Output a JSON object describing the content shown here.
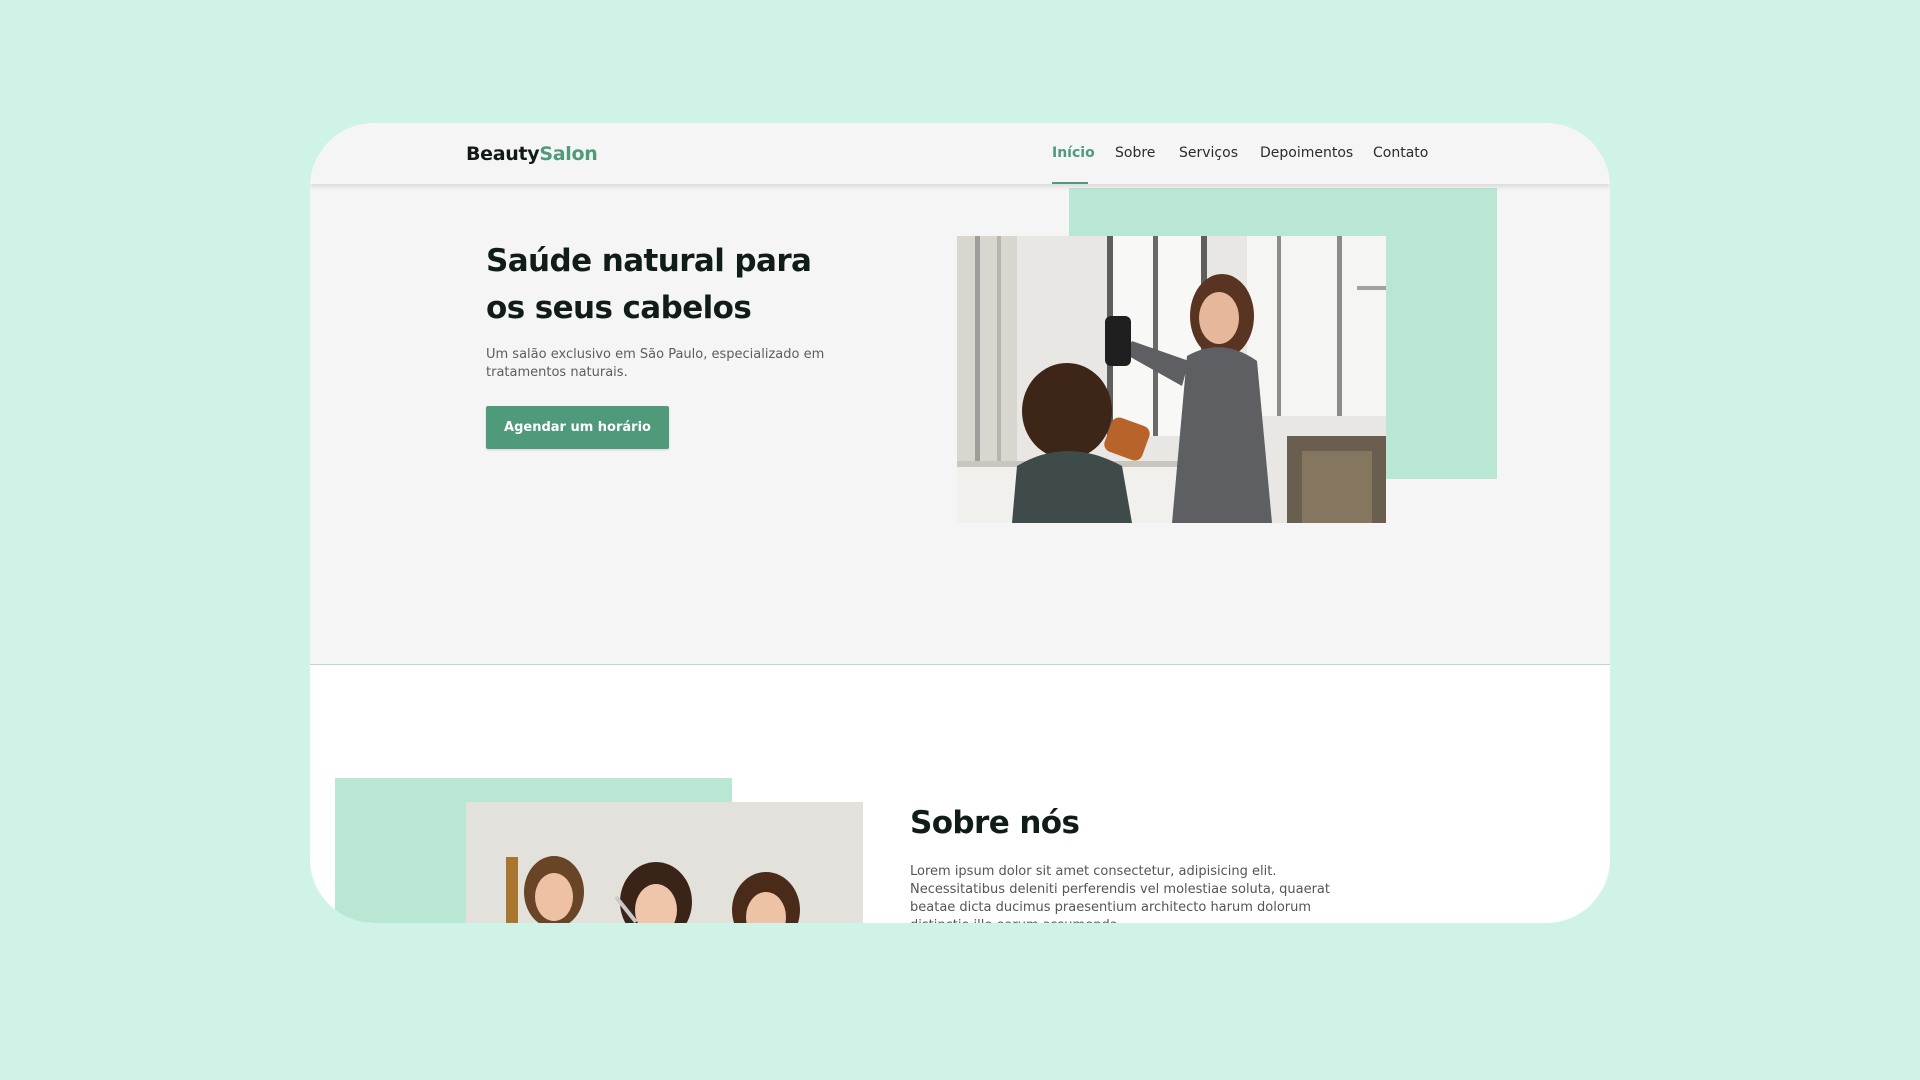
{
  "brand": {
    "name_part1": "Beauty",
    "name_part2": "Salon"
  },
  "nav": {
    "items": [
      {
        "label": "Início",
        "active": true
      },
      {
        "label": "Sobre",
        "active": false
      },
      {
        "label": "Serviços",
        "active": false
      },
      {
        "label": "Depoimentos",
        "active": false
      },
      {
        "label": "Contato",
        "active": false
      }
    ]
  },
  "hero": {
    "title": "Saúde natural para os seus cabelos",
    "subtitle": "Um salão exclusivo em São Paulo, especializado em tratamentos naturais.",
    "cta_label": "Agendar um horário"
  },
  "about": {
    "title": "Sobre nós",
    "text": "Lorem ipsum dolor sit amet consectetur, adipisicing elit. Necessitatibus deleniti perferendis vel molestiae soluta, quaerat beatae dicta ducimus praesentium architecto harum dolorum distinctio illo earum assumenda"
  },
  "colors": {
    "accent": "#4f9a7b",
    "accent_light": "#bae6d4",
    "page_background": "#cff3e6",
    "surface": "#f5f5f5",
    "heading": "#0f1c17"
  }
}
